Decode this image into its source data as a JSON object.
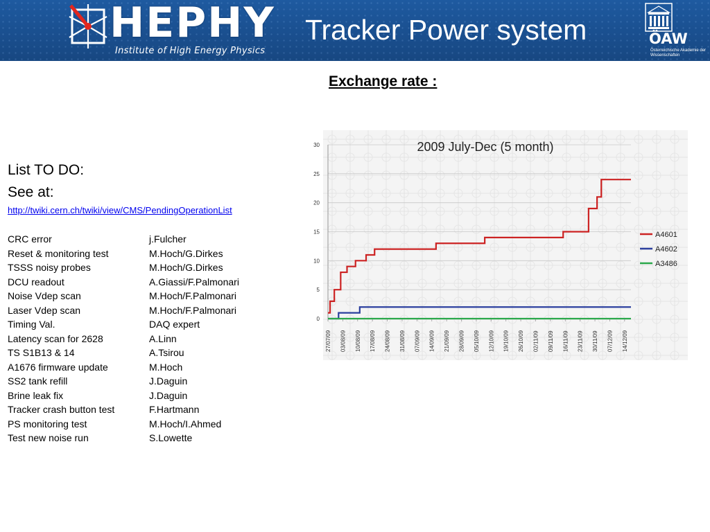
{
  "header": {
    "logo_text": "HEPHY",
    "institute_name": "Institute of High Energy Physics",
    "title": "Tracker Power system",
    "oaw_logo_text": "ÖAW",
    "oaw_subtitle": "Österreichische Akademie der Wissenschaften",
    "brand_color": "#1a4f8f"
  },
  "exchange_title": "Exchange rate :",
  "todo": {
    "heading": "List TO DO:",
    "see_at": "See at:",
    "link": "http://twiki.cern.ch/twiki/view/CMS/PendingOperationList",
    "items": [
      {
        "task": "CRC error",
        "owner": "j.Fulcher"
      },
      {
        "task": "Reset & monitoring test",
        "owner": "M.Hoch/G.Dirkes"
      },
      {
        "task": "TSSS noisy probes",
        "owner": "M.Hoch/G.Dirkes"
      },
      {
        "task": "DCU readout",
        "owner": "A.Giassi/F.Palmonari"
      },
      {
        "task": "Noise Vdep scan",
        "owner": "M.Hoch/F.Palmonari"
      },
      {
        "task": "Laser Vdep scan",
        "owner": "M.Hoch/F.Palmonari"
      },
      {
        "task": "Timing Val.",
        "owner": "DAQ expert"
      },
      {
        "task": "Latency scan for 2628",
        "owner": "A.Linn"
      },
      {
        "task": "TS S1B13 & 14",
        "owner": "A.Tsirou"
      },
      {
        "task": "A1676 firmware update",
        "owner": "M.Hoch"
      },
      {
        "task": "SS2 tank refill",
        "owner": "J.Daguin"
      },
      {
        "task": "Brine leak fix",
        "owner": "J.Daguin"
      },
      {
        "task": "Tracker crash button test",
        "owner": "F.Hartmann"
      },
      {
        "task": "PS monitoring test",
        "owner": "M.Hoch/I.Ahmed"
      },
      {
        "task": "Test new noise run",
        "owner": "S.Lowette"
      }
    ]
  },
  "chart_data": {
    "type": "line",
    "title": "2009 July-Dec (5 month)",
    "x_ticks": [
      "27/07/09",
      "03/08/09",
      "10/08/09",
      "17/08/09",
      "24/08/09",
      "31/08/09",
      "07/09/09",
      "14/09/09",
      "21/09/09",
      "28/09/09",
      "05/10/09",
      "12/10/09",
      "19/10/09",
      "26/10/09",
      "02/11/09",
      "09/11/09",
      "16/11/09",
      "23/11/09",
      "30/11/09",
      "07/12/09",
      "14/12/09"
    ],
    "x_range": [
      "27/07/09",
      "17/12/09"
    ],
    "ylim": [
      0,
      30
    ],
    "y_ticks": [
      0,
      5,
      10,
      15,
      20,
      25,
      30
    ],
    "grid": "horizontal",
    "legend_position": "right",
    "series": [
      {
        "name": "A4601",
        "color": "#cc2222",
        "step": true,
        "points": [
          [
            "27/07/09",
            1
          ],
          [
            "28/07/09",
            3
          ],
          [
            "30/07/09",
            5
          ],
          [
            "02/08/09",
            8
          ],
          [
            "05/08/09",
            9
          ],
          [
            "09/08/09",
            10
          ],
          [
            "14/08/09",
            11
          ],
          [
            "18/08/09",
            12
          ],
          [
            "16/09/09",
            13
          ],
          [
            "09/10/09",
            14
          ],
          [
            "15/11/09",
            15
          ],
          [
            "27/11/09",
            19
          ],
          [
            "01/12/09",
            21
          ],
          [
            "03/12/09",
            24
          ],
          [
            "17/12/09",
            24
          ]
        ]
      },
      {
        "name": "A4602",
        "color": "#2b3f9e",
        "step": true,
        "points": [
          [
            "27/07/09",
            0
          ],
          [
            "01/08/09",
            1
          ],
          [
            "11/08/09",
            2
          ],
          [
            "17/12/09",
            2
          ]
        ]
      },
      {
        "name": "A3486",
        "color": "#2aa84a",
        "step": true,
        "points": [
          [
            "27/07/09",
            0
          ],
          [
            "17/12/09",
            0
          ]
        ]
      }
    ]
  }
}
